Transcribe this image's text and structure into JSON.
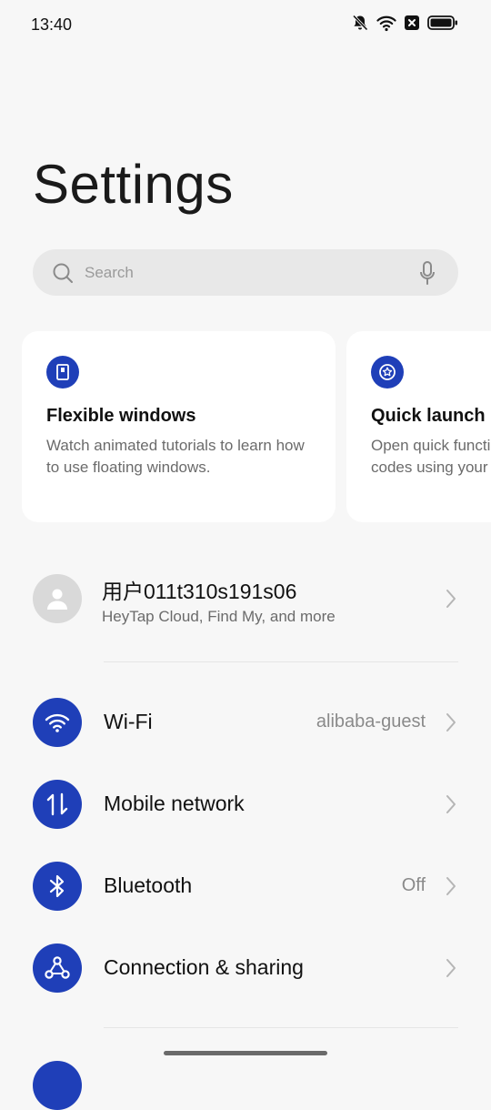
{
  "status_bar": {
    "time": "13:40"
  },
  "page": {
    "title": "Settings"
  },
  "search": {
    "placeholder": "Search"
  },
  "cards": [
    {
      "title": "Flexible windows",
      "description": "Watch animated tutorials to learn how to use floating windows.",
      "icon": "window-icon"
    },
    {
      "title": "Quick launch",
      "description": "Open quick functions like payment codes using your device.",
      "icon": "star-badge-icon"
    }
  ],
  "account": {
    "name": "用户011t310s191s06",
    "subtitle": "HeyTap Cloud, Find My, and more"
  },
  "settings": [
    {
      "label": "Wi-Fi",
      "value": "alibaba-guest",
      "icon": "wifi-icon"
    },
    {
      "label": "Mobile network",
      "value": "",
      "icon": "mobile-data-icon"
    },
    {
      "label": "Bluetooth",
      "value": "Off",
      "icon": "bluetooth-icon"
    },
    {
      "label": "Connection & sharing",
      "value": "",
      "icon": "connection-sharing-icon"
    }
  ],
  "colors": {
    "accent": "#1f3fb8",
    "background": "#f7f7f7",
    "card": "#ffffff"
  }
}
